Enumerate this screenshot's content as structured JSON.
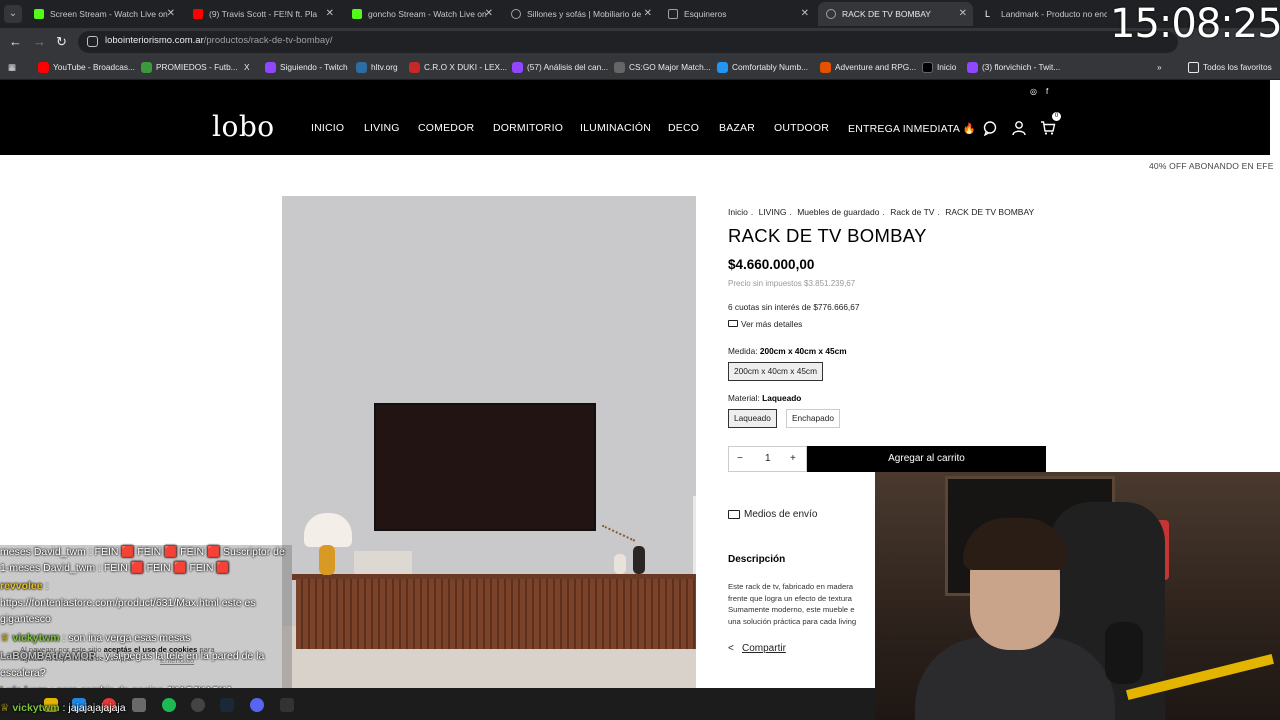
{
  "browser": {
    "tabs": [
      {
        "label": "Screen Stream - Watch Live on",
        "color": "#53fc18"
      },
      {
        "label": "(9) Travis Scott - FE!N ft. Pla",
        "color": "#ff0000"
      },
      {
        "label": "goncho Stream - Watch Live on",
        "color": "#53fc18"
      },
      {
        "label": "Sillones y sofás | Mobiliario de",
        "color": "#9aa0a6"
      },
      {
        "label": "Esquineros",
        "color": "#9aa0a6"
      },
      {
        "label": "RACK DE TV BOMBAY",
        "color": "#9aa0a6"
      },
      {
        "label": "Landmark - Producto no encon",
        "color": "#ffffff"
      }
    ],
    "url_host": "lobointeriorismo.com.ar",
    "url_path": "/productos/rack-de-tv-bombay/",
    "bookmarks": [
      {
        "label": "YouTube - Broadcas...",
        "color": "#ff0000"
      },
      {
        "label": "PROMIEDOS - Futb...",
        "color": "#3c9a3c"
      },
      {
        "label": "X",
        "color": "#000000"
      },
      {
        "label": "Siguiendo - Twitch",
        "color": "#9146ff"
      },
      {
        "label": "hltv.org",
        "color": "#2d6da3"
      },
      {
        "label": "C.R.O X DUKI - LEX...",
        "color": "#c62828"
      },
      {
        "label": "(57) Análisis del can...",
        "color": "#9146ff"
      },
      {
        "label": "CS:GO Major Match...",
        "color": "#666666"
      },
      {
        "label": "Comfortably Numb...",
        "color": "#2196f3"
      },
      {
        "label": "Adventure and RPG...",
        "color": "#e65100"
      },
      {
        "label": "Inicio",
        "color": "#000000"
      },
      {
        "label": "(3) florvichich - Twit...",
        "color": "#9146ff"
      }
    ],
    "bookmarks_more": "»",
    "all_favorites": "Todos los favoritos"
  },
  "clock": "15:08:25",
  "site": {
    "logo": "lobo",
    "nav": [
      "INICIO",
      "LIVING",
      "COMEDOR",
      "DORMITORIO",
      "ILUMINACIÓN",
      "DECO",
      "BAZAR",
      "OUTDOOR",
      "ENTREGA INMEDIATA 🔥"
    ],
    "cart_count": "0",
    "promo": "40% OFF ABONANDO EN EFE"
  },
  "product": {
    "breadcrumb": [
      "Inicio",
      ".",
      "LIVING",
      ".",
      "Muebles de guardado",
      ".",
      "Rack de TV",
      ".",
      "RACK DE TV BOMBAY"
    ],
    "title": "RACK DE TV BOMBAY",
    "price": "$4.660.000,00",
    "price_no_tax": "Precio sin impuestos $3.851.239,67",
    "installments": "6 cuotas sin interés de $776.666,67",
    "details_link": "Ver más detalles",
    "size_label": "Medida:",
    "size_value": "200cm x 40cm x 45cm",
    "size_option": "200cm x 40cm x 45cm",
    "material_label": "Material:",
    "material_value": "Laqueado",
    "material_options": [
      "Laqueado",
      "Enchapado"
    ],
    "qty_minus": "−",
    "qty": "1",
    "qty_plus": "+",
    "add_to_cart": "Agregar al carrito",
    "shipping": "Medios de envío",
    "description_title": "Descripción",
    "description_lines": [
      "Este rack de tv, fabricado en madera",
      "frente que logra un efecto de textura",
      "Sumamente moderno, este mueble e",
      "una solución práctica para cada living"
    ],
    "share": "Compartir"
  },
  "chat": {
    "messages": [
      {
        "user": "",
        "text": "meses David_twm : FEIN 🟥 FEIN 🟥 FEIN 🟥 Suscriptor de",
        "color": "#ffffff"
      },
      {
        "user": "",
        "text": "1-meses David_twm : FEIN 🟥 FEIN 🟥 FEIN 🟥",
        "color": "#ffffff"
      },
      {
        "user": "revvolee",
        "text": " :",
        "color": "#e6c229"
      },
      {
        "user": "",
        "text": "https://fontenlastore.com/product/631/Max.html este es",
        "color": "#ffffff"
      },
      {
        "user": "",
        "text": "gigantesco",
        "color": "#ffffff"
      },
      {
        "user": "vickytwm",
        "text": " : son ina verga esas mesas",
        "color": "#7ec23b"
      },
      {
        "user": "LaBOMBAdeAMOR",
        "text": " : y si pegas la tele en la pared de la",
        "color": "#c2c2c2"
      },
      {
        "user": "",
        "text": "escalera?",
        "color": "#ffffff"
      },
      {
        "user": "Luis l wm",
        "text": " : pero cambia de pagina JKASJKASKJ",
        "color": "#b06be6"
      },
      {
        "user": "vickytwm",
        "text": " : jajajajajajaja",
        "color": "#7ec23b"
      }
    ]
  },
  "cookie": {
    "text_pre": "Al navegar por este sitio",
    "text_bold": "aceptás el uso de cookies",
    "text_post": "para",
    "line2": "agilizar tu experiencia de compra.",
    "accept": "Entendido"
  }
}
